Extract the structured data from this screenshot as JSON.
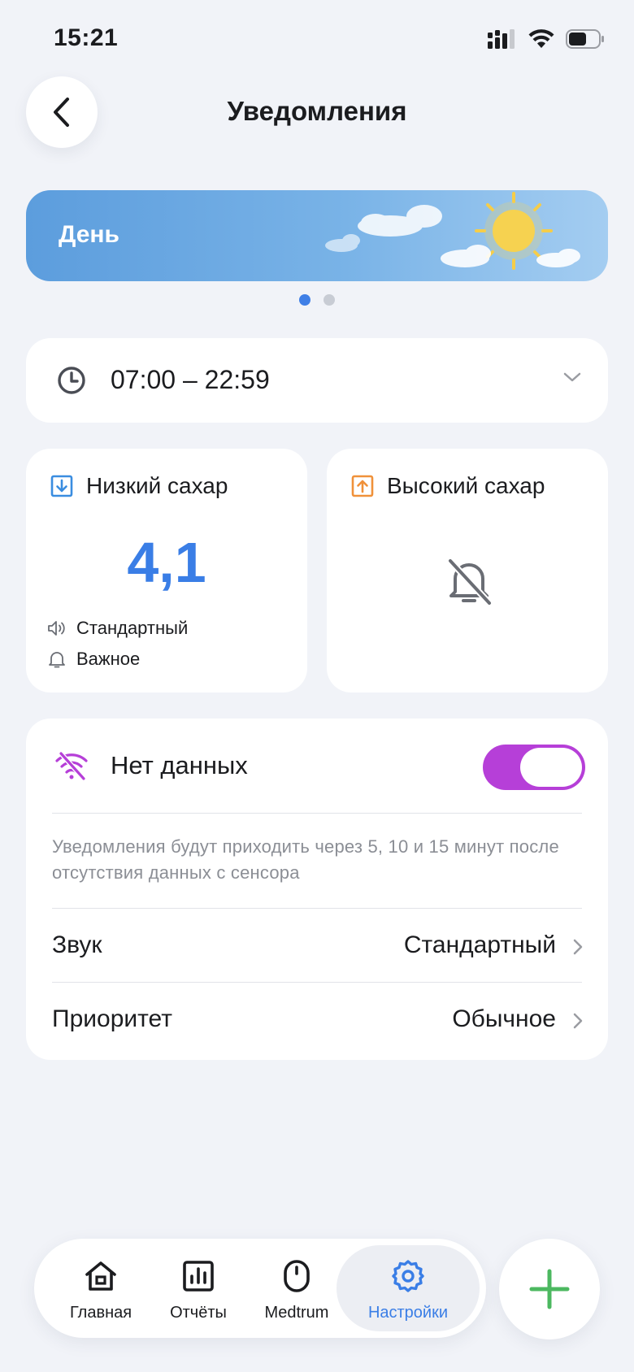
{
  "status_bar": {
    "time": "15:21"
  },
  "header": {
    "title": "Уведомления"
  },
  "banner": {
    "label": "День",
    "page_count": 2,
    "active_page": 1
  },
  "time_range": {
    "value": "07:00 – 22:59"
  },
  "low_sugar": {
    "label": "Низкий сахар",
    "value": "4,1",
    "sound": "Стандартный",
    "priority": "Важное"
  },
  "high_sugar": {
    "label": "Высокий сахар"
  },
  "no_data": {
    "label": "Нет данных",
    "enabled": true,
    "description": "Уведомления будут приходить через 5, 10 и 15 минут после отсутствия данных с сенсора",
    "sound": {
      "name": "Звук",
      "value": "Стандартный"
    },
    "priority": {
      "name": "Приоритет",
      "value": "Обычное"
    }
  },
  "tabs": {
    "home": "Главная",
    "reports": "Отчёты",
    "medtrum": "Medtrum",
    "settings": "Настройки",
    "active": "settings"
  },
  "colors": {
    "accent_blue": "#3a7ee6",
    "low_icon": "#3a8de0",
    "high_icon": "#f0913a",
    "toggle_on": "#b63fd8",
    "nodata_icon": "#b63fd8",
    "fab_plus": "#4cb860"
  },
  "icons": {
    "back": "chevron-left-icon",
    "clock": "clock-icon",
    "dropdown": "chevron-down-icon",
    "low": "arrow-down-box-icon",
    "high": "arrow-up-box-icon",
    "bell_off": "bell-off-icon",
    "no_data": "wifi-off-icon",
    "home": "house-icon",
    "reports": "bar-chart-icon",
    "medtrum": "sensor-icon",
    "settings": "gear-icon",
    "add": "plus-icon"
  }
}
